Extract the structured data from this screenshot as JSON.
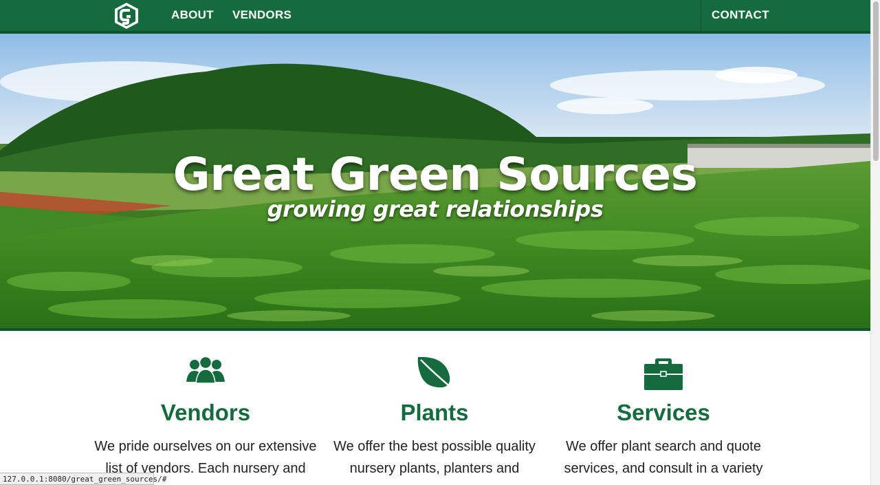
{
  "nav": {
    "about": "ABOUT",
    "vendors": "VENDORS",
    "contact": "CONTACT"
  },
  "hero": {
    "title": "Great Green Sources",
    "subtitle": "growing great relationships"
  },
  "features": [
    {
      "icon": "users-icon",
      "title": "Vendors",
      "text": "We pride ourselves on our extensive list of vendors. Each nursery and"
    },
    {
      "icon": "leaf-icon",
      "title": "Plants",
      "text": "We offer the best possible quality nursery plants, planters and"
    },
    {
      "icon": "briefcase-icon",
      "title": "Services",
      "text": "We offer plant search and quote services, and consult in a variety"
    }
  ],
  "status_url": "127.0.0.1:8080/great_green_sources/#",
  "colors": {
    "brand": "#166b3e",
    "brand_dark": "#0f5430",
    "text": "#222222"
  }
}
